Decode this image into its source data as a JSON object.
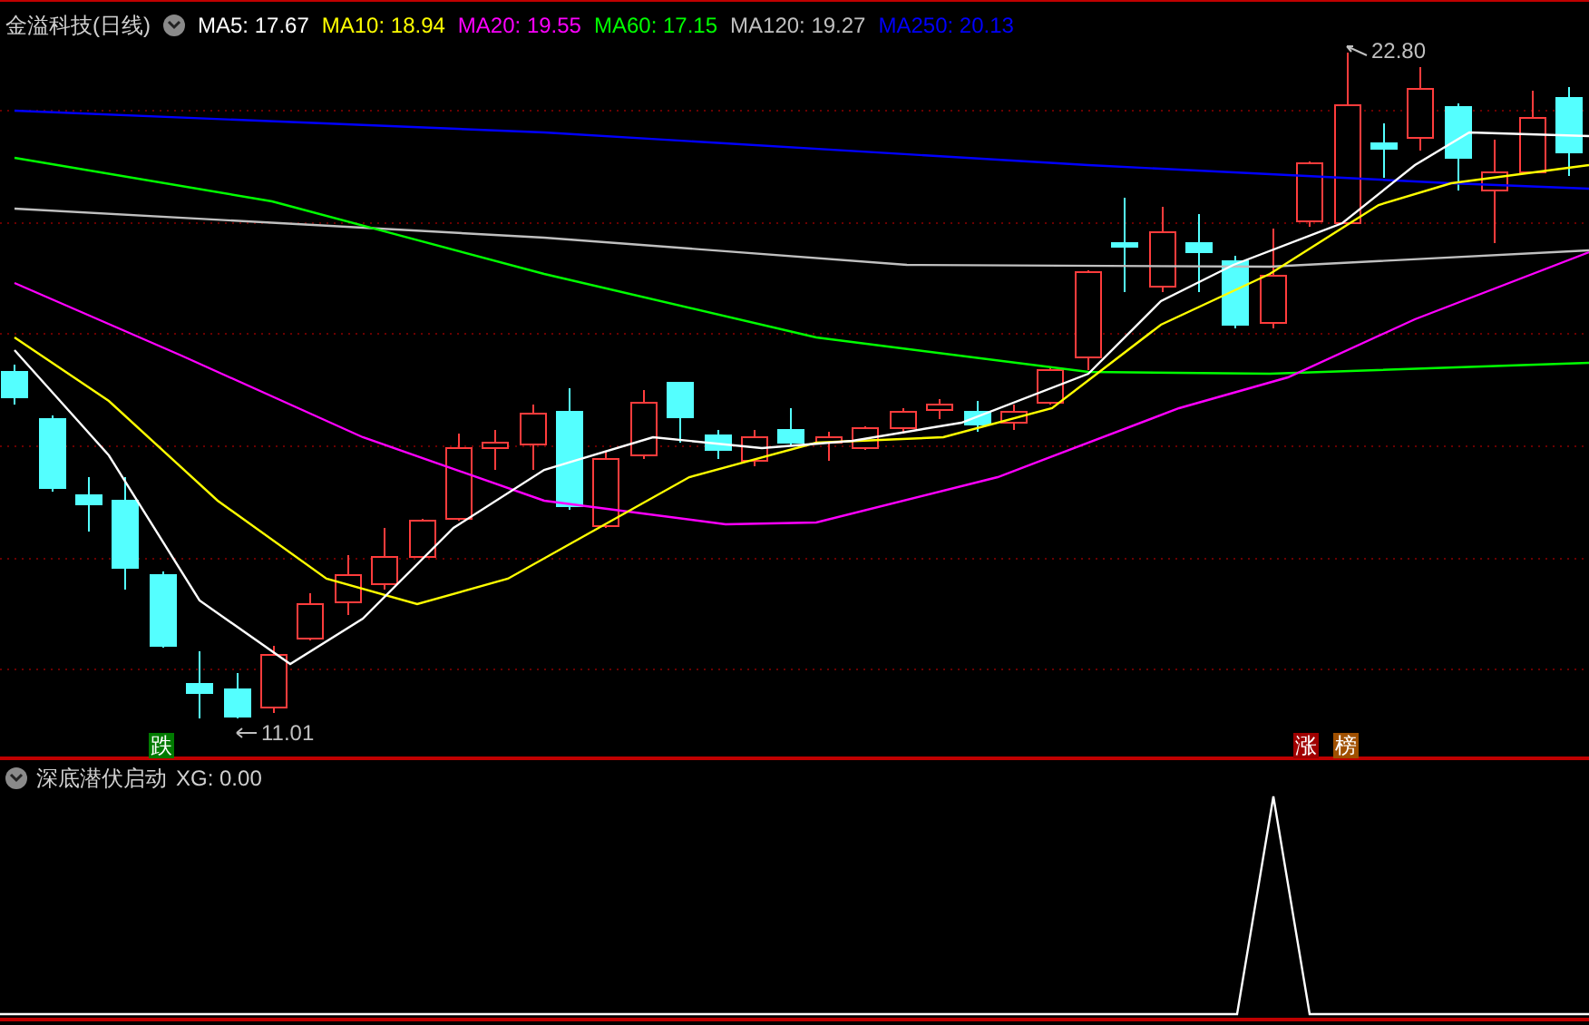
{
  "title": "金溢科技(日线)",
  "indicators": [
    {
      "label": "MA5: 17.67",
      "color": "#ffffff"
    },
    {
      "label": "MA10: 18.94",
      "color": "#ffff00"
    },
    {
      "label": "MA20: 19.55",
      "color": "#ff00ff"
    },
    {
      "label": "MA60: 17.15",
      "color": "#00ff00"
    },
    {
      "label": "MA120: 19.27",
      "color": "#c0c0c0"
    },
    {
      "label": "MA250: 20.13",
      "color": "#0000ff"
    }
  ],
  "price_labels": [
    {
      "text": "22.80"
    },
    {
      "text": "11.01"
    }
  ],
  "markers": [
    {
      "text": "跌",
      "color": "#007a00"
    },
    {
      "text": "涨",
      "color": "#a00000"
    },
    {
      "text": "榜",
      "color": "#a05000"
    }
  ],
  "lower_panel": {
    "title": "深底潜伏启动",
    "value": "XG: 0.00"
  }
}
